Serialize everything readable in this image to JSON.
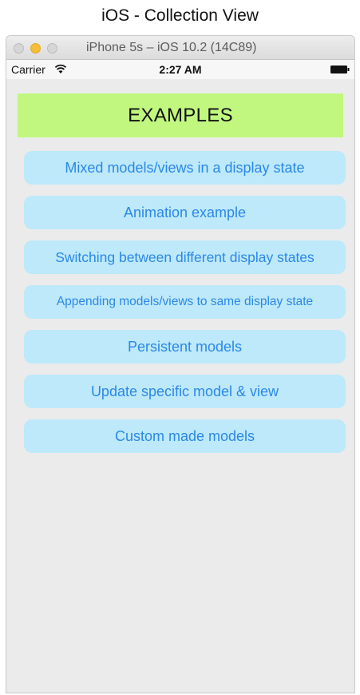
{
  "page_heading": "iOS - Collection View",
  "simulator": {
    "window_title": "iPhone 5s – iOS 10.2 (14C89)"
  },
  "status_bar": {
    "carrier": "Carrier",
    "time": "2:27 AM",
    "wifi_icon": "wifi-icon",
    "battery_icon": "battery-icon"
  },
  "screen": {
    "header": "EXAMPLES",
    "items": [
      {
        "label": "Mixed models/views in a display state"
      },
      {
        "label": "Animation example"
      },
      {
        "label": "Switching between different display states"
      },
      {
        "label": "Appending models/views to same display state"
      },
      {
        "label": "Persistent models"
      },
      {
        "label": "Update specific model & view"
      },
      {
        "label": "Custom made models"
      }
    ]
  },
  "colors": {
    "header_bg": "#c1f77f",
    "button_bg": "#bde9fb",
    "button_text": "#2c88e6",
    "screen_bg": "#ebebeb"
  }
}
